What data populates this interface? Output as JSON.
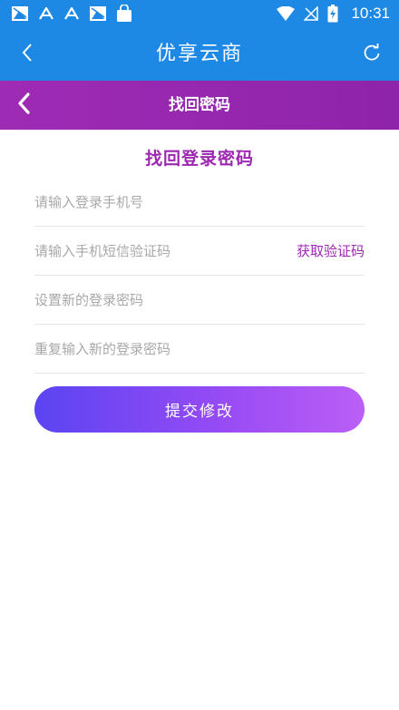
{
  "status_bar": {
    "time": "10:31",
    "left_icons": [
      "image-notification-icon",
      "a-notification-icon",
      "a-notification-icon",
      "image-notification-icon",
      "shopping-bag-icon"
    ],
    "right_icons": [
      "wifi-icon",
      "no-signal-icon",
      "battery-charging-icon"
    ]
  },
  "app_bar": {
    "title": "优享云商"
  },
  "page_header": {
    "title": "找回密码"
  },
  "form": {
    "title": "找回登录密码",
    "phone_placeholder": "请输入登录手机号",
    "code_placeholder": "请输入手机短信验证码",
    "get_code_label": "获取验证码",
    "new_password_placeholder": "设置新的登录密码",
    "repeat_password_placeholder": "重复输入新的登录密码",
    "submit_label": "提交修改"
  },
  "colors": {
    "app_bar": "#1e88e5",
    "header": "#9c27b0",
    "accent": "#9c27b0",
    "button_start": "#5b44f2",
    "button_end": "#bb5ff6"
  }
}
